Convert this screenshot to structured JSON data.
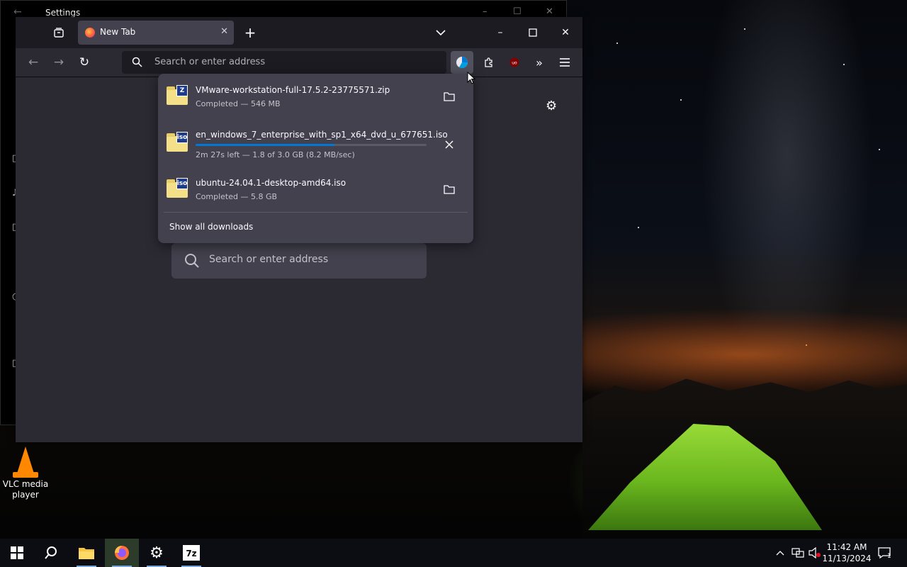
{
  "settings_window": {
    "title": "Settings"
  },
  "browser": {
    "tab": {
      "title": "New Tab"
    },
    "urlbar_placeholder": "Search or enter address",
    "content_search_placeholder": "Search or enter address"
  },
  "downloads": {
    "items": [
      {
        "name": "VMware-workstation-full-17.5.2-23775571.zip",
        "status": "Completed — 546 MB",
        "badge": "Z",
        "progress": 1.0,
        "action": "show-in-folder"
      },
      {
        "name": "en_windows_7_enterprise_with_sp1_x64_dvd_u_677651.iso",
        "status": "2m 27s left — 1.8 of 3.0 GB (8.2 MB/sec)",
        "badge": "iso",
        "progress": 0.6,
        "action": "cancel"
      },
      {
        "name": "ubuntu-24.04.1-desktop-amd64.iso",
        "status": "Completed — 5.8 GB",
        "badge": "iso",
        "progress": 1.0,
        "action": "show-in-folder"
      }
    ],
    "show_all": "Show all downloads"
  },
  "desktop": {
    "vlc_label": "VLC media player"
  },
  "taskbar": {
    "time": "11:42 AM",
    "date": "11/13/2024",
    "notification_count": "1"
  },
  "colors": {
    "accent": "#0078d4",
    "panel": "#42414d",
    "browser_bg": "#2b2a33",
    "tabbar": "#1c1b22"
  }
}
